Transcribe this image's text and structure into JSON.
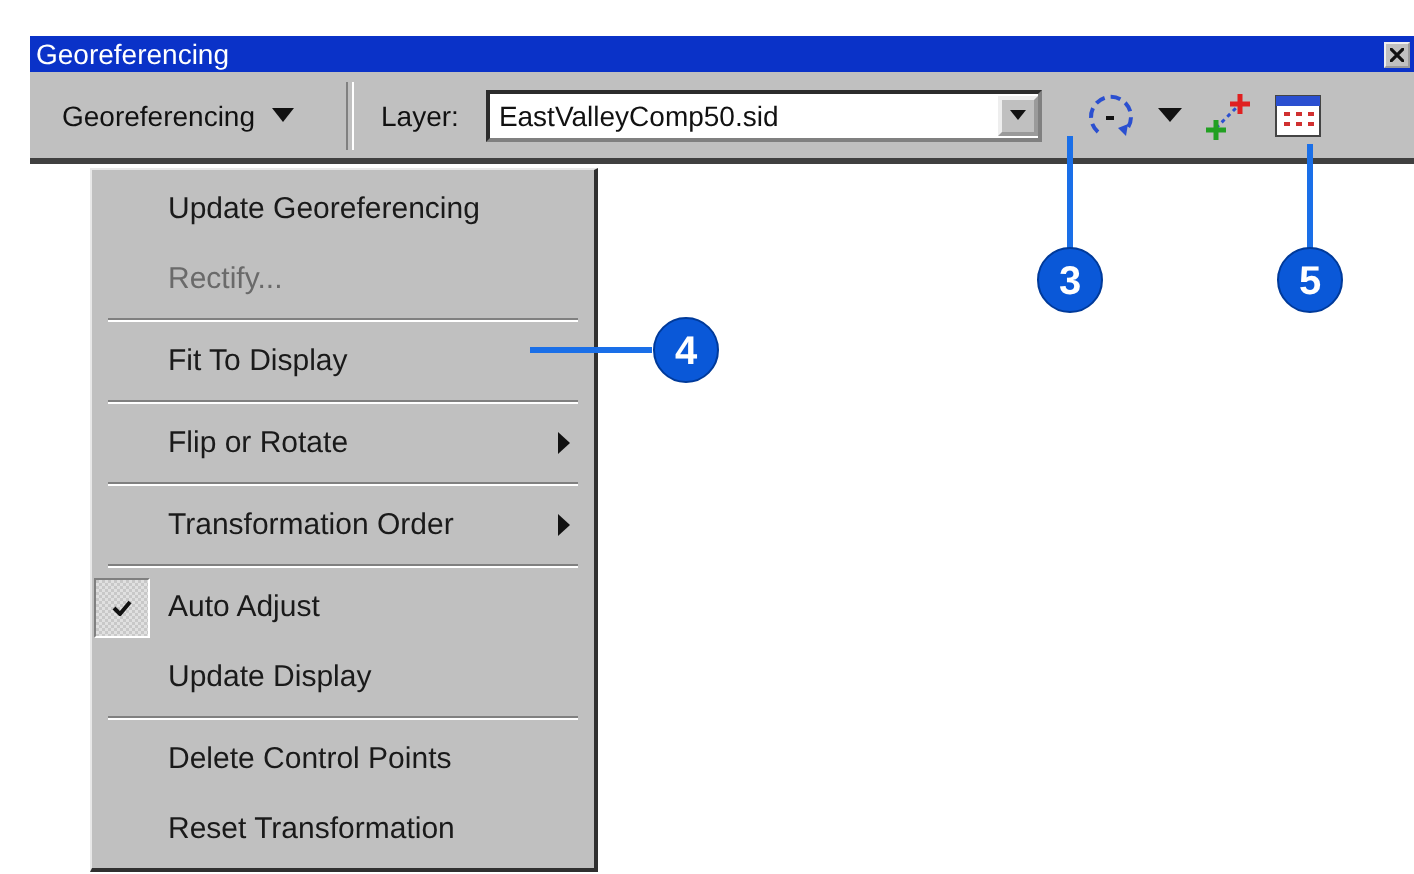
{
  "window": {
    "title": "Georeferencing"
  },
  "toolbar": {
    "menu_button": "Georeferencing",
    "layer_label": "Layer:",
    "layer_value": "EastValleyComp50.sid"
  },
  "menu": [
    {
      "kind": "item",
      "label": "Update Georeferencing",
      "disabled": false,
      "checked": false,
      "submenu": false
    },
    {
      "kind": "item",
      "label": "Rectify...",
      "disabled": true,
      "checked": false,
      "submenu": false
    },
    {
      "kind": "separator"
    },
    {
      "kind": "item",
      "label": "Fit To Display",
      "disabled": false,
      "checked": false,
      "submenu": false
    },
    {
      "kind": "separator"
    },
    {
      "kind": "item",
      "label": "Flip or Rotate",
      "disabled": false,
      "checked": false,
      "submenu": true
    },
    {
      "kind": "separator"
    },
    {
      "kind": "item",
      "label": "Transformation Order",
      "disabled": false,
      "checked": false,
      "submenu": true
    },
    {
      "kind": "separator"
    },
    {
      "kind": "item",
      "label": "Auto Adjust",
      "disabled": false,
      "checked": true,
      "submenu": false
    },
    {
      "kind": "item",
      "label": "Update Display",
      "disabled": false,
      "checked": false,
      "submenu": false
    },
    {
      "kind": "separator"
    },
    {
      "kind": "item",
      "label": "Delete Control Points",
      "disabled": false,
      "checked": false,
      "submenu": false
    },
    {
      "kind": "item",
      "label": "Reset Transformation",
      "disabled": false,
      "checked": false,
      "submenu": false
    }
  ],
  "callouts": [
    "3",
    "4",
    "5"
  ]
}
